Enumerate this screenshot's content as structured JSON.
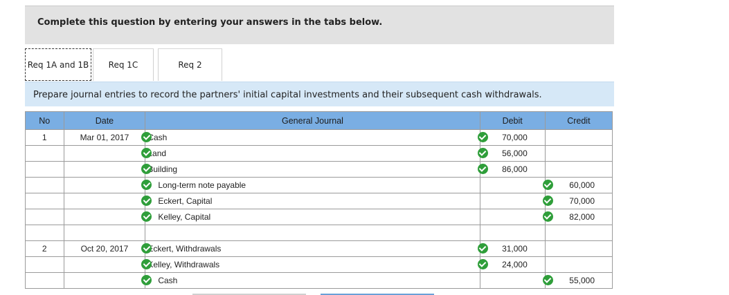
{
  "header": {
    "text": "Complete this question by entering your answers in the tabs below."
  },
  "tabs": [
    {
      "label": "Req 1A and 1B",
      "active": true
    },
    {
      "label": "Req 1C",
      "active": false
    },
    {
      "label": "Req 2",
      "active": false
    }
  ],
  "instruction": "Prepare journal entries to record the partners' initial capital investments and their subsequent cash withdrawals.",
  "table": {
    "headers": {
      "no": "No",
      "date": "Date",
      "journal": "General Journal",
      "debit": "Debit",
      "credit": "Credit"
    },
    "rows": [
      {
        "no": "1",
        "date": "Mar 01, 2017",
        "account": "Cash",
        "indent": false,
        "debit": "70,000",
        "credit": ""
      },
      {
        "no": "",
        "date": "",
        "account": "Land",
        "indent": false,
        "debit": "56,000",
        "credit": ""
      },
      {
        "no": "",
        "date": "",
        "account": "Building",
        "indent": false,
        "debit": "86,000",
        "credit": ""
      },
      {
        "no": "",
        "date": "",
        "account": "Long-term note payable",
        "indent": true,
        "debit": "",
        "credit": "60,000"
      },
      {
        "no": "",
        "date": "",
        "account": "Eckert, Capital",
        "indent": true,
        "debit": "",
        "credit": "70,000"
      },
      {
        "no": "",
        "date": "",
        "account": "Kelley, Capital",
        "indent": true,
        "debit": "",
        "credit": "82,000"
      },
      {
        "no": "",
        "date": "",
        "account": "",
        "indent": false,
        "debit": "",
        "credit": "",
        "blank": true
      },
      {
        "no": "2",
        "date": "Oct 20, 2017",
        "account": "Eckert, Withdrawals",
        "indent": false,
        "debit": "31,000",
        "credit": ""
      },
      {
        "no": "",
        "date": "",
        "account": "Kelley, Withdrawals",
        "indent": false,
        "debit": "24,000",
        "credit": ""
      },
      {
        "no": "",
        "date": "",
        "account": "Cash",
        "indent": true,
        "debit": "",
        "credit": "55,000"
      }
    ]
  },
  "colors": {
    "header_bg": "#e2e2e2",
    "instruction_bg": "#d6e8f7",
    "table_header_bg": "#7aaee3",
    "check_green": "#2f9e3a"
  }
}
